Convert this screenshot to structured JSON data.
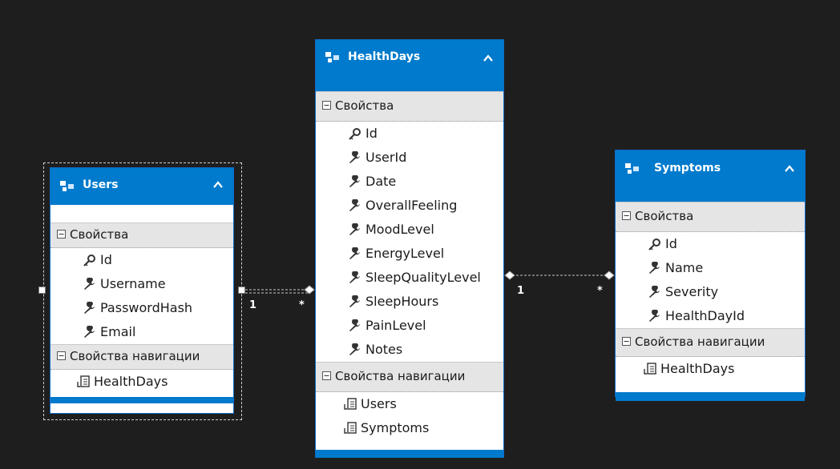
{
  "entities": {
    "users": {
      "name": "Users",
      "sections": {
        "properties": "Свойства",
        "navigation": "Свойства навигации"
      },
      "properties": [
        "Id",
        "Username",
        "PasswordHash",
        "Email"
      ],
      "navigation": [
        "HealthDays"
      ]
    },
    "healthdays": {
      "name": "HealthDays",
      "sections": {
        "properties": "Свойства",
        "navigation": "Свойства навигации"
      },
      "properties": [
        "Id",
        "UserId",
        "Date",
        "OverallFeeling",
        "MoodLevel",
        "EnergyLevel",
        "SleepQualityLevel",
        "SleepHours",
        "PainLevel",
        "Notes"
      ],
      "navigation": [
        "Users",
        "Symptoms"
      ]
    },
    "symptoms": {
      "name": "Symptoms",
      "sections": {
        "properties": "Свойства",
        "navigation": "Свойства навигации"
      },
      "properties": [
        "Id",
        "Name",
        "Severity",
        "HealthDayId"
      ],
      "navigation": [
        "HealthDays"
      ]
    }
  },
  "associations": [
    {
      "from": "Users",
      "to": "HealthDays",
      "from_multiplicity": "1",
      "to_multiplicity": "*"
    },
    {
      "from": "HealthDays",
      "to": "Symptoms",
      "from_multiplicity": "1",
      "to_multiplicity": "*"
    }
  ],
  "colors": {
    "background": "#1e1e1e",
    "header": "#007acc",
    "section": "#e5e5e5",
    "body": "#ffffff"
  },
  "icons": {
    "entity": "entity-type-icon",
    "collapse": "chevron-up-icon",
    "section": "minus-box-icon",
    "key": "key-icon",
    "property": "wrench-icon",
    "navigation": "navigation-property-icon"
  }
}
